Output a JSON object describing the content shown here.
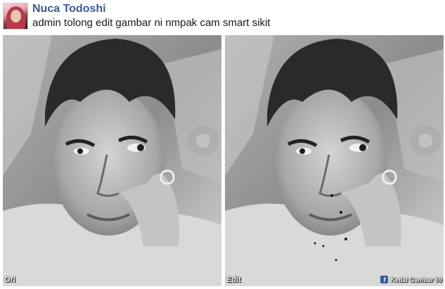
{
  "post": {
    "author": "Nuca Todoshi",
    "text": "admin tolong edit gambar ni nmpak cam smart sikit"
  },
  "photos": {
    "left_label": "Ori",
    "right_label": "Edit",
    "watermark": "Kedai Gambar 69",
    "watermark_icon": "facebook-icon"
  }
}
